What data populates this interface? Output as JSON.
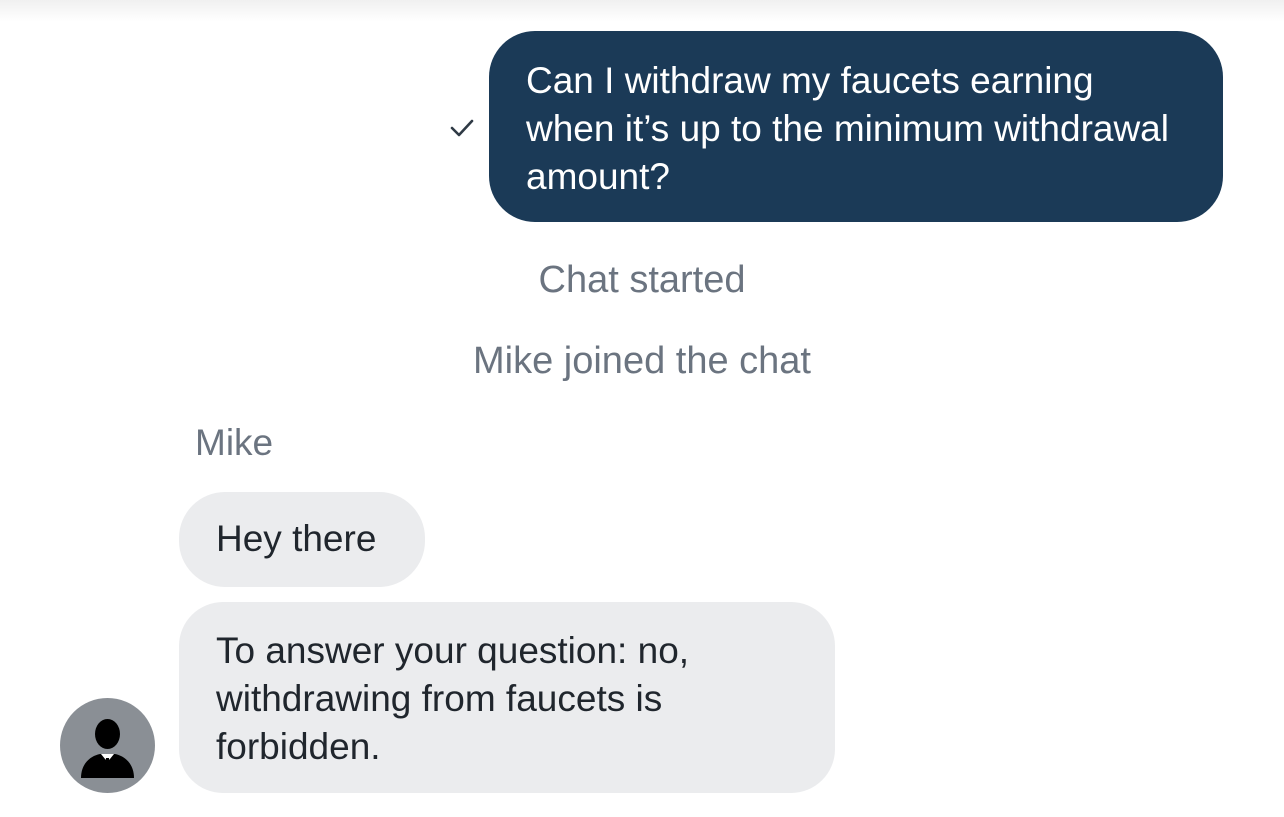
{
  "conversation": {
    "outgoing": {
      "text": "Can I withdraw my faucets earning when it’s up to the minimum withdrawal amount?",
      "status_icon": "checkmark-icon"
    },
    "system": {
      "chat_started": "Chat started",
      "agent_joined": "Mike joined the chat"
    },
    "agent": {
      "name": "Mike",
      "avatar_icon": "person-silhouette-icon",
      "messages": [
        "Hey there",
        "To answer your question: no, withdrawing from faucets is forbidden."
      ]
    }
  },
  "colors": {
    "outgoing_bubble": "#1b3a57",
    "incoming_bubble": "#ebecee",
    "system_text": "#6b7480",
    "avatar_bg": "#8a8f95"
  }
}
